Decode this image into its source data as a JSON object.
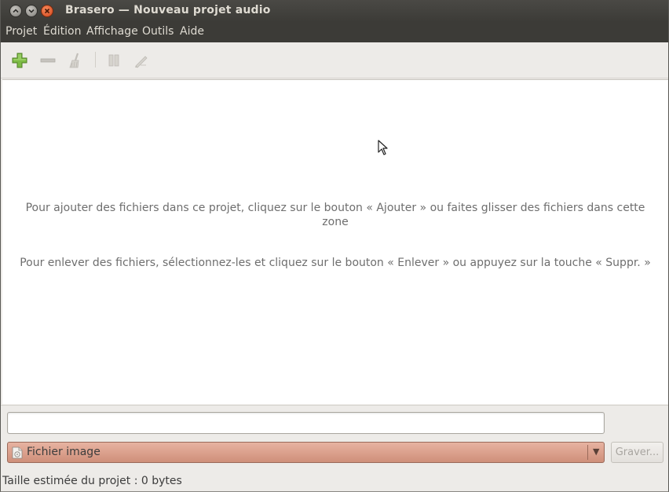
{
  "window": {
    "title": "Brasero — Nouveau projet audio"
  },
  "menubar": {
    "items": [
      "Projet",
      "Édition",
      "Affichage",
      "Outils",
      "Aide"
    ]
  },
  "toolbar": {
    "buttons": [
      {
        "icon": "add-icon",
        "enabled": true
      },
      {
        "icon": "remove-icon",
        "enabled": false
      },
      {
        "icon": "clear-icon",
        "enabled": false
      },
      {
        "icon": "split-icon",
        "enabled": false
      },
      {
        "icon": "edit-icon",
        "enabled": false
      }
    ]
  },
  "content": {
    "hint_add": "Pour ajouter des fichiers dans ce projet, cliquez sur le bouton « Ajouter » ou faites glisser des fichiers dans cette zone",
    "hint_remove": "Pour enlever des fichiers, sélectionnez-les et cliquez sur le bouton « Enlever » ou appuyez sur la touche « Suppr. »"
  },
  "bottom": {
    "name_value": "",
    "destination": "Fichier image",
    "burn_label": "Graver..."
  },
  "status": {
    "size_text": "Taille estimée du projet : 0 bytes"
  },
  "colors": {
    "titlebar": "#3c3b37",
    "combo": "#d99a85",
    "add_green": "#6aa83a"
  }
}
